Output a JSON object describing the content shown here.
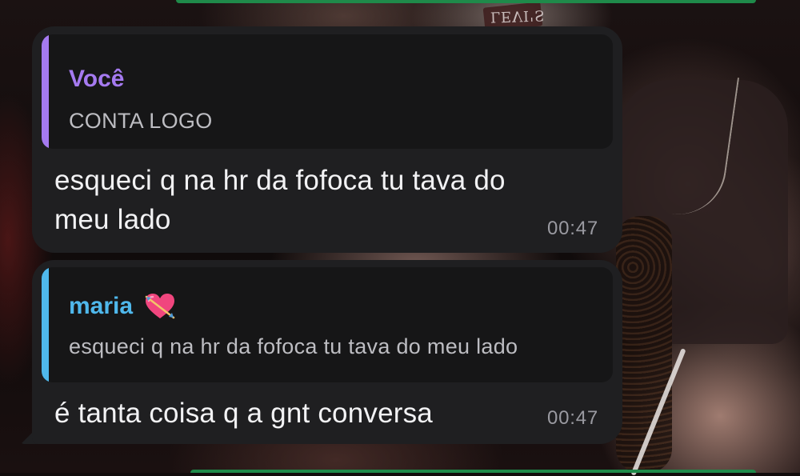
{
  "wallpaper": {
    "shirt_text": "LEVI'S"
  },
  "messages": [
    {
      "reply": {
        "author": "Você",
        "author_color": "#a57af0",
        "text": "CONTA LOGO"
      },
      "text": "esqueci q na hr da fofoca tu tava do meu lado",
      "time": "00:47"
    },
    {
      "reply": {
        "author": "maria",
        "author_color": "#4fb8ec",
        "author_icon": "heart-with-arrow-icon",
        "text": "esqueci q na hr da fofoca tu tava do meu lado"
      },
      "text": "é tanta coisa q a gnt conversa",
      "time": "00:47"
    }
  ],
  "colors": {
    "bubble_bg": "#1f1f21",
    "quote_bg": "#161617",
    "accent_green": "#1f8a4a"
  }
}
